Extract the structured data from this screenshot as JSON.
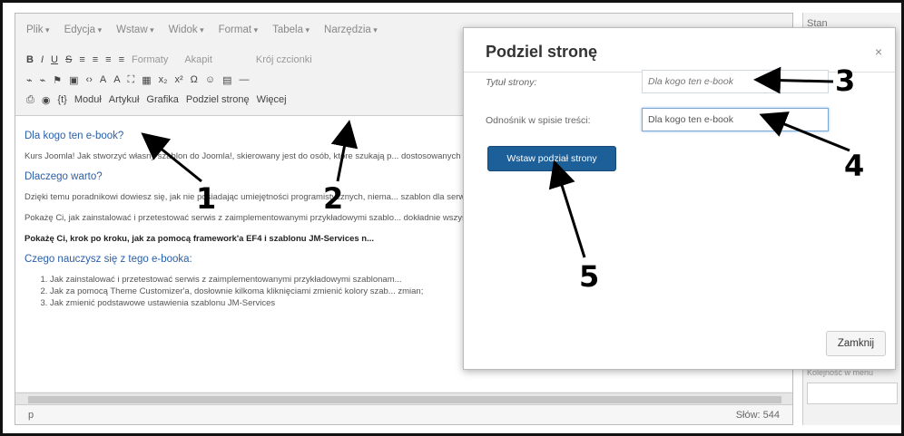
{
  "menu": [
    "Plik",
    "Edycja",
    "Wstaw",
    "Widok",
    "Format",
    "Tabela",
    "Narzędzia"
  ],
  "toolbar": {
    "row1": [
      "B",
      "I",
      "U",
      "S",
      "≡",
      "≡",
      "≡",
      "≡",
      "Formaty",
      "Akapit",
      "Krój czcionki"
    ],
    "row2": [
      "⌁",
      "⌁",
      "⚑",
      "▣",
      "‹›",
      "A",
      "A",
      "⛶",
      "▦",
      "x₂",
      "x²",
      "Ω",
      "☺",
      "▤",
      "—"
    ],
    "row3_icons": [
      "⎙",
      "◉",
      "{t}"
    ],
    "modul": "Moduł",
    "artykul": "Artykuł",
    "grafika": "Grafika",
    "podziel": "Podziel stronę",
    "wiecej": "Więcej"
  },
  "content": {
    "h1": "Dla kogo ten e-book?",
    "p1": "Kurs Joomla! Jak stworzyć własny szablon do Joomla!, skierowany jest do osób, które szukają p... dostosowanych do wymagań swojego serwisu.",
    "h2": "Dlaczego warto?",
    "p2": "Dzięki temu poradnikowi dowiesz się, jak nie posiadając umiejętności programistycznych, niema... szablon dla serwisu zbudowanego w oparciu o CMS Joomla!",
    "p3": "Pokażę Ci, jak zainstalować i przetestować serwis z zaimplementowanymi przykładowymi szablo... dokładnie wszystkie opcje potrzebne do utworzenia własnego szablonu.",
    "p4": "Pokażę Ci, krok po kroku, jak za pomocą framework'a EF4 i szablonu JM-Services n...",
    "h3": "Czego nauczysz się z tego e-booka:",
    "list": [
      "Jak zainstalować i przetestować serwis z zaimplementowanymi przykładowymi szablonam...",
      "Jak za pomocą Theme Customizer'a, dosłownie kilkoma kliknięciami zmienić kolory szab... zmian;",
      "Jak zmienić podstawowe ustawienia szablonu JM-Services"
    ]
  },
  "status": {
    "path": "p",
    "words": "Słów: 544"
  },
  "side": {
    "label": "Stan",
    "label2": "Kolejność w menu"
  },
  "modal": {
    "title": "Podziel stronę",
    "close_icon": "×",
    "title_label": "Tytuł strony:",
    "title_placeholder": "Dla kogo ten e-book",
    "toc_label": "Odnośnik w spisie treści:",
    "toc_value": "Dla kogo ten e-book",
    "insert_button": "Wstaw podział strony",
    "close_button": "Zamknij"
  },
  "callouts": [
    "1",
    "2",
    "3",
    "4",
    "5"
  ]
}
